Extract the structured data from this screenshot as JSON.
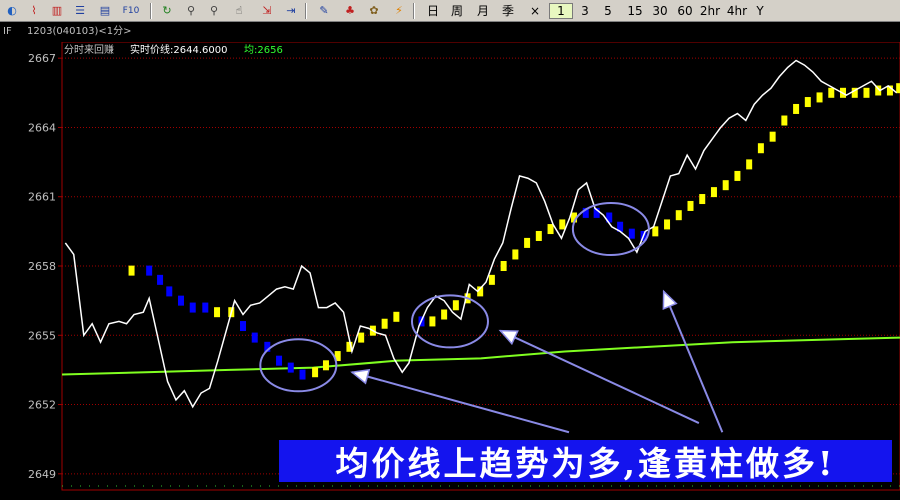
{
  "toolbar": {
    "icons": [
      {
        "name": "home-icon",
        "glyph": "◐",
        "color": "#2060c0"
      },
      {
        "name": "line-chart-icon",
        "glyph": "⌇",
        "color": "#c02020"
      },
      {
        "name": "candlestick-icon",
        "glyph": "▥",
        "color": "#c02020"
      },
      {
        "name": "list-icon",
        "glyph": "☰",
        "color": "#2040a0"
      },
      {
        "name": "news-icon",
        "glyph": "▤",
        "color": "#2040a0"
      },
      {
        "name": "f10-icon",
        "glyph": "F10",
        "color": "#2040a0"
      },
      {
        "name": "refresh-icon",
        "glyph": "↻",
        "color": "#208020"
      },
      {
        "name": "zoom-in-icon",
        "glyph": "⚲",
        "color": "#404040"
      },
      {
        "name": "zoom-out-icon",
        "glyph": "⚲",
        "color": "#404040"
      },
      {
        "name": "select-icon",
        "glyph": "☝",
        "color": "#404040"
      },
      {
        "name": "download-icon",
        "glyph": "⇲",
        "color": "#c02020"
      },
      {
        "name": "export-icon",
        "glyph": "⇥",
        "color": "#2040a0"
      },
      {
        "name": "edit-icon",
        "glyph": "✎",
        "color": "#2040a0"
      },
      {
        "name": "alarm-icon",
        "glyph": "♣",
        "color": "#c02020"
      },
      {
        "name": "people-icon",
        "glyph": "✿",
        "color": "#806020"
      },
      {
        "name": "flash-icon",
        "glyph": "⚡",
        "color": "#e08000"
      }
    ],
    "periods": [
      "日",
      "周",
      "月",
      "季",
      "×",
      "1",
      "3",
      "5",
      "15",
      "30",
      "60",
      "2hr",
      "4hr",
      "Y"
    ],
    "selected_period": "1"
  },
  "info": {
    "symbol": "IF",
    "contract": "1203(040103)<1分>",
    "mode": "分时来回赚",
    "price_label": "实时价线:2644.6000",
    "avg_label": "均:2656"
  },
  "chart_data": {
    "type": "line",
    "y_ticks": [
      "2667",
      "2664",
      "2661",
      "2658",
      "2655",
      "2652",
      "2649"
    ],
    "ylim": [
      2648.3,
      2667.7
    ],
    "xlim": [
      0,
      100
    ],
    "series": [
      {
        "key": "price",
        "color": "#ffffff",
        "points": [
          [
            0.4,
            2659
          ],
          [
            1.4,
            2658.5
          ],
          [
            2.6,
            2655
          ],
          [
            3.6,
            2655.5
          ],
          [
            4.6,
            2654.7
          ],
          [
            5.6,
            2655.5
          ],
          [
            6.8,
            2655.6
          ],
          [
            7.7,
            2655.5
          ],
          [
            8.6,
            2655.9
          ],
          [
            9.7,
            2656
          ],
          [
            10.4,
            2656.6
          ],
          [
            11.5,
            2654.8
          ],
          [
            12.6,
            2653
          ],
          [
            13.6,
            2652.2
          ],
          [
            14.6,
            2652.6
          ],
          [
            15.6,
            2651.9
          ],
          [
            16.6,
            2652.5
          ],
          [
            17.6,
            2652.7
          ],
          [
            18.6,
            2653.9
          ],
          [
            19.6,
            2655.2
          ],
          [
            20.6,
            2656.5
          ],
          [
            21.6,
            2655.9
          ],
          [
            22.5,
            2656.3
          ],
          [
            23.6,
            2656.4
          ],
          [
            24.6,
            2656.7
          ],
          [
            25.6,
            2657
          ],
          [
            26.6,
            2657.1
          ],
          [
            27.6,
            2657
          ],
          [
            28.6,
            2658
          ],
          [
            29.6,
            2657.7
          ],
          [
            30.6,
            2656.2
          ],
          [
            31.6,
            2656.2
          ],
          [
            32.6,
            2656.4
          ],
          [
            33.6,
            2656
          ],
          [
            34.6,
            2654.3
          ],
          [
            35.6,
            2655.4
          ],
          [
            36.6,
            2655.3
          ],
          [
            37.6,
            2655.1
          ],
          [
            38.6,
            2655
          ],
          [
            39.6,
            2654
          ],
          [
            40.6,
            2653.4
          ],
          [
            41.4,
            2653.8
          ],
          [
            42.6,
            2655.4
          ],
          [
            43.6,
            2656.2
          ],
          [
            44.6,
            2656.7
          ],
          [
            45.6,
            2656.5
          ],
          [
            46.6,
            2656
          ],
          [
            47.6,
            2655.7
          ],
          [
            48.6,
            2657.2
          ],
          [
            49.6,
            2656.9
          ],
          [
            50.6,
            2657.3
          ],
          [
            51.6,
            2658.3
          ],
          [
            52.6,
            2659
          ],
          [
            53.6,
            2660.5
          ],
          [
            54.6,
            2661.9
          ],
          [
            55.6,
            2661.8
          ],
          [
            56.6,
            2661.6
          ],
          [
            57.6,
            2660.8
          ],
          [
            58.6,
            2659.8
          ],
          [
            59.6,
            2659.2
          ],
          [
            60.6,
            2660.1
          ],
          [
            61.6,
            2661.3
          ],
          [
            62.6,
            2661.6
          ],
          [
            63.6,
            2660.5
          ],
          [
            64.6,
            2660.2
          ],
          [
            65.6,
            2659.7
          ],
          [
            66.6,
            2659.5
          ],
          [
            67.6,
            2659.2
          ],
          [
            68.6,
            2658.6
          ],
          [
            69.6,
            2659.5
          ],
          [
            70.6,
            2659.7
          ],
          [
            71.6,
            2660.8
          ],
          [
            72.6,
            2661.9
          ],
          [
            73.6,
            2662
          ],
          [
            74.6,
            2662.8
          ],
          [
            75.6,
            2662.2
          ],
          [
            76.6,
            2663
          ],
          [
            77.6,
            2663.5
          ],
          [
            78.6,
            2664
          ],
          [
            79.6,
            2664.4
          ],
          [
            80.6,
            2664.6
          ],
          [
            81.6,
            2664.3
          ],
          [
            82.6,
            2665
          ],
          [
            83.6,
            2665.4
          ],
          [
            84.6,
            2665.7
          ],
          [
            85.6,
            2666.2
          ],
          [
            86.6,
            2666.6
          ],
          [
            87.6,
            2666.9
          ],
          [
            88.6,
            2666.7
          ],
          [
            89.6,
            2666.4
          ],
          [
            90.6,
            2666
          ],
          [
            91.6,
            2665.8
          ],
          [
            92.6,
            2665.6
          ],
          [
            93.6,
            2665.4
          ],
          [
            94.6,
            2665.6
          ],
          [
            95.6,
            2665.8
          ],
          [
            96.6,
            2666
          ],
          [
            97.6,
            2665.6
          ],
          [
            98.6,
            2665.8
          ],
          [
            99.6,
            2665.5
          ]
        ]
      },
      {
        "key": "average",
        "color": "#80ff20",
        "points": [
          [
            0,
            2653.3
          ],
          [
            10,
            2653.4
          ],
          [
            20,
            2653.5
          ],
          [
            30,
            2653.6
          ],
          [
            40,
            2653.9
          ],
          [
            50,
            2654
          ],
          [
            60,
            2654.3
          ],
          [
            70,
            2654.5
          ],
          [
            80,
            2654.7
          ],
          [
            90,
            2654.8
          ],
          [
            100,
            2654.9
          ]
        ]
      }
    ],
    "bars": [
      {
        "x": 8.3,
        "y": 2657.8,
        "color": "#ffff00"
      },
      {
        "x": 10.4,
        "y": 2657.8,
        "color": "#0000ff"
      },
      {
        "x": 11.7,
        "y": 2657.4,
        "color": "#0000ff"
      },
      {
        "x": 12.8,
        "y": 2656.9,
        "color": "#0000ff"
      },
      {
        "x": 14.2,
        "y": 2656.5,
        "color": "#0000ff"
      },
      {
        "x": 15.6,
        "y": 2656.2,
        "color": "#0000ff"
      },
      {
        "x": 17.1,
        "y": 2656.2,
        "color": "#0000ff"
      },
      {
        "x": 18.5,
        "y": 2656,
        "color": "#ffff00"
      },
      {
        "x": 20.2,
        "y": 2656,
        "color": "#ffff00"
      },
      {
        "x": 21.6,
        "y": 2655.4,
        "color": "#0000ff"
      },
      {
        "x": 23.0,
        "y": 2654.9,
        "color": "#0000ff"
      },
      {
        "x": 24.5,
        "y": 2654.5,
        "color": "#0000ff"
      },
      {
        "x": 25.9,
        "y": 2653.9,
        "color": "#0000ff"
      },
      {
        "x": 27.3,
        "y": 2653.6,
        "color": "#0000ff"
      },
      {
        "x": 28.7,
        "y": 2653.3,
        "color": "#0000ff"
      },
      {
        "x": 30.2,
        "y": 2653.4,
        "color": "#ffff00"
      },
      {
        "x": 31.5,
        "y": 2653.7,
        "color": "#ffff00"
      },
      {
        "x": 32.9,
        "y": 2654.1,
        "color": "#ffff00"
      },
      {
        "x": 34.3,
        "y": 2654.5,
        "color": "#ffff00"
      },
      {
        "x": 35.7,
        "y": 2654.9,
        "color": "#ffff00"
      },
      {
        "x": 37.1,
        "y": 2655.2,
        "color": "#ffff00"
      },
      {
        "x": 38.5,
        "y": 2655.5,
        "color": "#ffff00"
      },
      {
        "x": 39.9,
        "y": 2655.8,
        "color": "#ffff00"
      },
      {
        "x": 42.9,
        "y": 2655.6,
        "color": "#0000ff"
      },
      {
        "x": 44.2,
        "y": 2655.6,
        "color": "#ffff00"
      },
      {
        "x": 45.6,
        "y": 2655.9,
        "color": "#ffff00"
      },
      {
        "x": 47.0,
        "y": 2656.3,
        "color": "#ffff00"
      },
      {
        "x": 48.4,
        "y": 2656.6,
        "color": "#ffff00"
      },
      {
        "x": 49.9,
        "y": 2656.9,
        "color": "#ffff00"
      },
      {
        "x": 51.3,
        "y": 2657.4,
        "color": "#ffff00"
      },
      {
        "x": 52.7,
        "y": 2658,
        "color": "#ffff00"
      },
      {
        "x": 54.1,
        "y": 2658.5,
        "color": "#ffff00"
      },
      {
        "x": 55.5,
        "y": 2659,
        "color": "#ffff00"
      },
      {
        "x": 56.9,
        "y": 2659.3,
        "color": "#ffff00"
      },
      {
        "x": 58.3,
        "y": 2659.6,
        "color": "#ffff00"
      },
      {
        "x": 59.7,
        "y": 2659.8,
        "color": "#ffff00"
      },
      {
        "x": 61.1,
        "y": 2660.1,
        "color": "#ffff00"
      },
      {
        "x": 62.5,
        "y": 2660.3,
        "color": "#0000ff"
      },
      {
        "x": 63.8,
        "y": 2660.3,
        "color": "#0000ff"
      },
      {
        "x": 65.3,
        "y": 2660.1,
        "color": "#0000ff"
      },
      {
        "x": 66.6,
        "y": 2659.7,
        "color": "#0000ff"
      },
      {
        "x": 68.0,
        "y": 2659.4,
        "color": "#0000ff"
      },
      {
        "x": 69.4,
        "y": 2659.3,
        "color": "#0000ff"
      },
      {
        "x": 70.8,
        "y": 2659.5,
        "color": "#ffff00"
      },
      {
        "x": 72.2,
        "y": 2659.8,
        "color": "#ffff00"
      },
      {
        "x": 73.6,
        "y": 2660.2,
        "color": "#ffff00"
      },
      {
        "x": 75.0,
        "y": 2660.6,
        "color": "#ffff00"
      },
      {
        "x": 76.4,
        "y": 2660.9,
        "color": "#ffff00"
      },
      {
        "x": 77.8,
        "y": 2661.2,
        "color": "#ffff00"
      },
      {
        "x": 79.2,
        "y": 2661.5,
        "color": "#ffff00"
      },
      {
        "x": 80.6,
        "y": 2661.9,
        "color": "#ffff00"
      },
      {
        "x": 82.0,
        "y": 2662.4,
        "color": "#ffff00"
      },
      {
        "x": 83.4,
        "y": 2663.1,
        "color": "#ffff00"
      },
      {
        "x": 84.8,
        "y": 2663.6,
        "color": "#ffff00"
      },
      {
        "x": 86.2,
        "y": 2664.3,
        "color": "#ffff00"
      },
      {
        "x": 87.6,
        "y": 2664.8,
        "color": "#ffff00"
      },
      {
        "x": 89.0,
        "y": 2665.1,
        "color": "#ffff00"
      },
      {
        "x": 90.4,
        "y": 2665.3,
        "color": "#ffff00"
      },
      {
        "x": 91.8,
        "y": 2665.5,
        "color": "#ffff00"
      },
      {
        "x": 93.2,
        "y": 2665.5,
        "color": "#ffff00"
      },
      {
        "x": 94.6,
        "y": 2665.5,
        "color": "#ffff00"
      },
      {
        "x": 96.0,
        "y": 2665.5,
        "color": "#ffff00"
      },
      {
        "x": 97.4,
        "y": 2665.6,
        "color": "#ffff00"
      },
      {
        "x": 98.8,
        "y": 2665.6,
        "color": "#ffff00"
      },
      {
        "x": 99.9,
        "y": 2665.7,
        "color": "#ffff00"
      }
    ],
    "annotations": {
      "circles": [
        [
          28.2,
          2653.7
        ],
        [
          46.3,
          2655.6
        ],
        [
          65.5,
          2659.6
        ]
      ],
      "arrows": [
        {
          "from": [
            60.5,
            2650.8
          ],
          "to": [
            34.6,
            2653.4
          ]
        },
        {
          "from": [
            76.0,
            2651.2
          ],
          "to": [
            52.3,
            2655.2
          ]
        },
        {
          "from": [
            78.8,
            2650.8
          ],
          "to": [
            71.8,
            2656.9
          ]
        }
      ],
      "color": "#8a8ae6"
    },
    "caption": "均价线上趋势为多,逢黄柱做多!"
  }
}
